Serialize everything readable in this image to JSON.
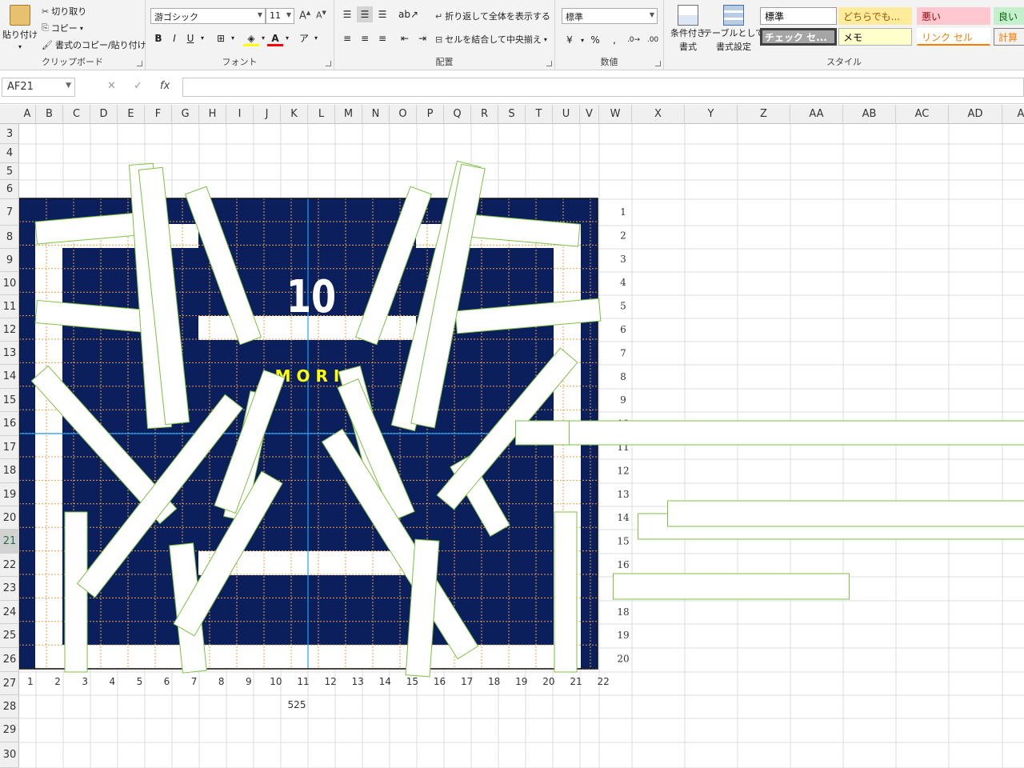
{
  "ribbon": {
    "clipboard": {
      "paste": "貼り付け",
      "cut": "切り取り",
      "copy": "コピー",
      "format_painter": "書式のコピー/貼り付け",
      "label": "クリップボード"
    },
    "font": {
      "name": "游ゴシック",
      "size": "11",
      "bold": "B",
      "italic": "I",
      "underline": "U",
      "label": "フォント"
    },
    "alignment": {
      "wrap_text": "折り返して全体を表示する",
      "merge_center": "セルを結合して中央揃え",
      "label": "配置"
    },
    "number": {
      "format": "標準",
      "percent": "%",
      "comma": ",",
      "label": "数値"
    },
    "styles_group": {
      "conditional": [
        "条件付き",
        "書式"
      ],
      "table": [
        "テーブルとして",
        "書式設定"
      ],
      "cells": [
        {
          "text": "標準",
          "bg": "#ffffff",
          "fg": "#000000",
          "border": "#9c9c9c"
        },
        {
          "text": "どちらでも...",
          "bg": "#ffeb9c",
          "fg": "#9c5700",
          "border": "#ffeb9c"
        },
        {
          "text": "悪い",
          "bg": "#ffc7ce",
          "fg": "#9c0006",
          "border": "#ffc7ce"
        },
        {
          "text": "良い",
          "bg": "#c6efce",
          "fg": "#006100",
          "border": "#c6efce"
        },
        {
          "text": "チェック セ...",
          "bg": "#a5a5a5",
          "fg": "#ffffff",
          "border": "#3f3f3f"
        },
        {
          "text": "メモ",
          "bg": "#ffffcc",
          "fg": "#000000",
          "border": "#b2b2b2"
        },
        {
          "text": "リンク セル",
          "bg": "#ffffff",
          "fg": "#fa7d00",
          "border": "#ffffff"
        },
        {
          "text": "計算",
          "bg": "#f2f2f2",
          "fg": "#fa7d00",
          "border": "#7f7f7f"
        }
      ],
      "label": "スタイル"
    }
  },
  "formula_bar": {
    "name_box": "AF21",
    "cancel_icon": "✕",
    "enter_icon": "✓",
    "fx": "fx",
    "value": ""
  },
  "columns": [
    "A",
    "B",
    "C",
    "D",
    "E",
    "F",
    "G",
    "H",
    "I",
    "J",
    "K",
    "L",
    "M",
    "N",
    "O",
    "P",
    "Q",
    "R",
    "S",
    "T",
    "U",
    "V",
    "W",
    "X",
    "Y",
    "Z",
    "AA",
    "AB",
    "AC",
    "AD",
    "A"
  ],
  "rows": [
    "3",
    "4",
    "5",
    "6",
    "7",
    "8",
    "9",
    "10",
    "11",
    "12",
    "13",
    "14",
    "15",
    "16",
    "17",
    "18",
    "19",
    "20",
    "21",
    "22",
    "23",
    "24",
    "25",
    "26",
    "27",
    "28",
    "29",
    "30"
  ],
  "selected_row": "21",
  "jersey": {
    "number": "10",
    "name": "M O R I",
    "navy": "#0a1f5c",
    "name_color": "#ffff00",
    "x_axis_numbers": [
      "1",
      "2",
      "3",
      "4",
      "5",
      "6",
      "7",
      "8",
      "9",
      "10",
      "11",
      "12",
      "13",
      "14",
      "15",
      "16",
      "17",
      "18",
      "19",
      "20",
      "21",
      "22"
    ],
    "y_axis_numbers": [
      "1",
      "2",
      "3",
      "4",
      "5",
      "6",
      "7",
      "8",
      "9",
      "10",
      "11",
      "12",
      "13",
      "14",
      "15",
      "16",
      "17",
      "18",
      "19",
      "20"
    ],
    "width_label": "525"
  },
  "colors": {
    "selection_green": "#217346",
    "guide_line": "#1aa3ff",
    "shape_outline": "#7dc242"
  }
}
